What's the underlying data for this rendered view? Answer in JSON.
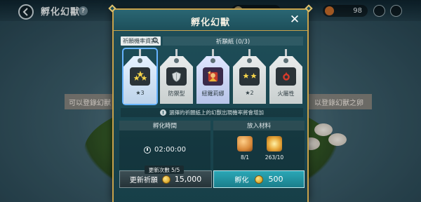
{
  "background": {
    "title": "孵化幻獸",
    "help_label": "?",
    "resources": [
      {
        "value": "",
        "color": "#c9b27a"
      },
      {
        "value": "98",
        "color": "#c46b2a"
      }
    ],
    "banner_left": "可以登錄幻獸",
    "banner_right": "以登錄幻獸之卵"
  },
  "dialog": {
    "title": "孵化幻獸",
    "close_label": "✕",
    "probability_button": "祈願機率資訊",
    "slip_header": "祈願紙 (0/3)",
    "tags": [
      {
        "label": "★3",
        "icon": "three-stars-icon",
        "selected": true
      },
      {
        "label": "防禦型",
        "icon": "shield-icon",
        "selected": false
      },
      {
        "label": "紐羅莉娜",
        "icon": "character-portrait-icon",
        "selected": false
      },
      {
        "label": "★2",
        "icon": "two-stars-icon",
        "selected": false
      },
      {
        "label": "火屬性",
        "icon": "fire-element-icon",
        "selected": false
      }
    ],
    "info_text": "選擇的祈願紙上的幻獸出現機率將會增加",
    "hatch_time": {
      "header": "孵化時間",
      "value": "02:00:00"
    },
    "materials": {
      "header": "放入材料",
      "items": [
        {
          "count": "8/1",
          "icon": "egg-material-icon",
          "color": "#d98a3a"
        },
        {
          "count": "263/10",
          "icon": "star-material-icon",
          "color": "#e8a83a"
        }
      ]
    },
    "update_badge": "更新次數 5/5",
    "refresh_button": {
      "label": "更新祈願",
      "price": "15,000"
    },
    "hatch_button": {
      "label": "孵化",
      "price": "500"
    }
  }
}
